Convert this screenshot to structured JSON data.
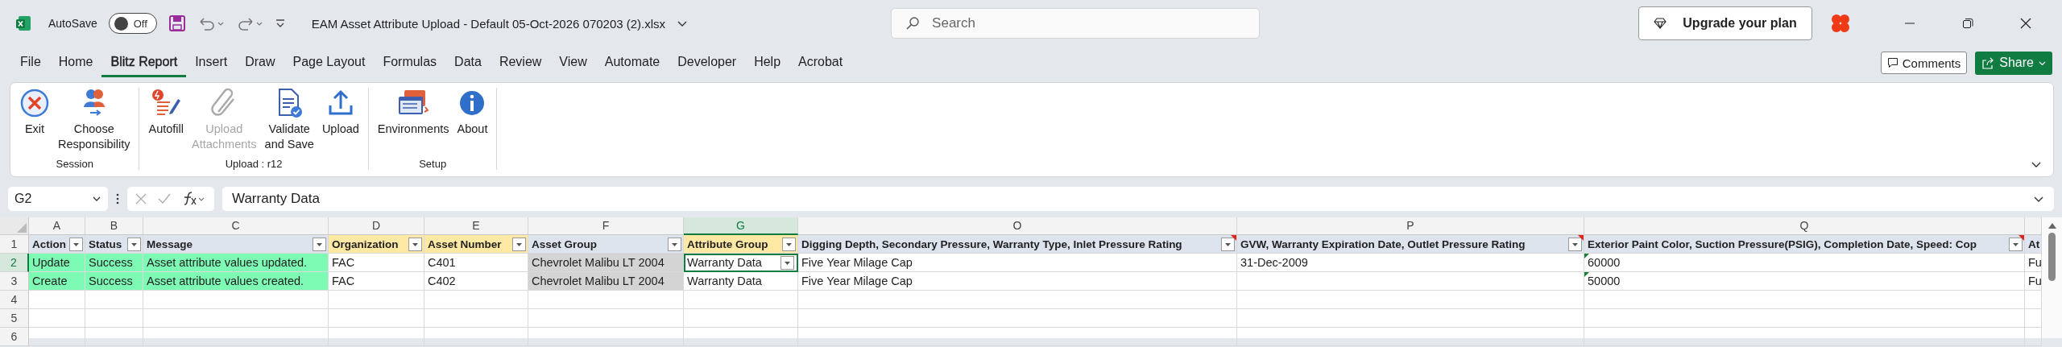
{
  "title_bar": {
    "autosave_label": "AutoSave",
    "autosave": {
      "label": "Off",
      "on": false
    },
    "file_name": "EAM Asset Attribute Upload - Default 05-Oct-2026 070203 (2).xlsx",
    "search": {
      "placeholder": "Search"
    },
    "upgrade_button": "Upgrade your plan"
  },
  "tabs": [
    {
      "label": "File",
      "selected": false
    },
    {
      "label": "Home",
      "selected": false
    },
    {
      "label": "Blitz Report",
      "selected": true
    },
    {
      "label": "Insert",
      "selected": false
    },
    {
      "label": "Draw",
      "selected": false
    },
    {
      "label": "Page Layout",
      "selected": false
    },
    {
      "label": "Formulas",
      "selected": false
    },
    {
      "label": "Data",
      "selected": false
    },
    {
      "label": "Review",
      "selected": false
    },
    {
      "label": "View",
      "selected": false
    },
    {
      "label": "Automate",
      "selected": false
    },
    {
      "label": "Developer",
      "selected": false
    },
    {
      "label": "Help",
      "selected": false
    },
    {
      "label": "Acrobat",
      "selected": false
    }
  ],
  "comments_button": "Comments",
  "share_button": "Share",
  "ribbon": {
    "groups": [
      {
        "label": "Session",
        "buttons": [
          {
            "kind": "exit",
            "lines": [
              "Exit"
            ],
            "disabled": false
          },
          {
            "kind": "responsibility",
            "lines": [
              "Choose",
              "Responsibility"
            ],
            "disabled": false
          }
        ]
      },
      {
        "label": "Upload : r12",
        "buttons": [
          {
            "kind": "autofill",
            "lines": [
              "Autofill"
            ],
            "disabled": false
          },
          {
            "kind": "attachment",
            "lines": [
              "Upload",
              "Attachments"
            ],
            "disabled": true
          },
          {
            "kind": "validate",
            "lines": [
              "Validate",
              "and Save"
            ],
            "disabled": false
          },
          {
            "kind": "upload",
            "lines": [
              "Upload"
            ],
            "disabled": false
          }
        ]
      },
      {
        "label": "Setup",
        "buttons": [
          {
            "kind": "environments",
            "lines": [
              "Environments"
            ],
            "disabled": false
          },
          {
            "kind": "about",
            "lines": [
              "About"
            ],
            "disabled": false
          }
        ]
      }
    ]
  },
  "formula_bar": {
    "name_box": "G2",
    "value": "Warranty Data"
  },
  "sheet": {
    "columns": [
      {
        "letter": "A",
        "header": "Action",
        "color": "#dde4ee",
        "comment": false,
        "selected": false
      },
      {
        "letter": "B",
        "header": "Status",
        "color": "#dde4ee",
        "comment": false,
        "selected": false
      },
      {
        "letter": "C",
        "header": "Message",
        "color": "#dde4ee",
        "comment": false,
        "selected": false
      },
      {
        "letter": "D",
        "header": "Organization",
        "color": "#fde8a4",
        "comment": false,
        "selected": false
      },
      {
        "letter": "E",
        "header": "Asset Number",
        "color": "#fde8a4",
        "comment": false,
        "selected": false
      },
      {
        "letter": "F",
        "header": "Asset Group",
        "color": "#dde4ee",
        "comment": false,
        "selected": false
      },
      {
        "letter": "G",
        "header": "Attribute Group",
        "color": "#fde8a4",
        "comment": false,
        "selected": true
      },
      {
        "letter": "O",
        "header": "Digging Depth, Secondary Pressure, Warranty Type, Inlet Pressure Rating",
        "color": "#dde4ee",
        "comment": true,
        "selected": false
      },
      {
        "letter": "P",
        "header": "GVW, Warranty Expiration Date, Outlet Pressure Rating",
        "color": "#dde4ee",
        "comment": true,
        "selected": false
      },
      {
        "letter": "Q",
        "header": "Exterior Paint Color, Suction Pressure(PSIG), Completion Date, Speed: Cop",
        "color": "#dde4ee",
        "comment": true,
        "selected": false
      },
      {
        "header": "At",
        "color": "#dde4ee",
        "comment": false,
        "selected": false
      }
    ],
    "header_row": {
      "number": "1",
      "selected": false
    },
    "rows": [
      {
        "number": "2",
        "selected": true,
        "cells": [
          {
            "text": "Update",
            "color": "#7dfab4"
          },
          {
            "text": "Success",
            "color": "#7dfab4"
          },
          {
            "text": "Asset attribute values updated.",
            "color": "#7dfab4"
          },
          {
            "text": "FAC"
          },
          {
            "text": "C401"
          },
          {
            "text": "Chevrolet Malibu LT 2004",
            "color": "#d4d4d4"
          },
          {
            "text": "Warranty Data"
          },
          {
            "text": "Five Year Milage Cap"
          },
          {
            "text": "31-Dec-2009"
          },
          {
            "text": "60000",
            "flag": true
          },
          {
            "text": "Fu"
          }
        ]
      },
      {
        "number": "3",
        "selected": false,
        "cells": [
          {
            "text": "Create",
            "color": "#7dfab4"
          },
          {
            "text": "Success",
            "color": "#7dfab4"
          },
          {
            "text": "Asset attribute values created.",
            "color": "#7dfab4"
          },
          {
            "text": "FAC"
          },
          {
            "text": "C402"
          },
          {
            "text": "Chevrolet Malibu LT 2004",
            "color": "#d4d4d4"
          },
          {
            "text": "Warranty Data"
          },
          {
            "text": "Five Year Milage Cap"
          },
          {},
          {
            "text": "50000",
            "flag": true
          },
          {
            "text": "Fu"
          }
        ]
      },
      {
        "number": "4",
        "selected": false,
        "cells": []
      },
      {
        "number": "5",
        "selected": false,
        "cells": []
      },
      {
        "number": "6",
        "selected": false,
        "cells": []
      }
    ]
  }
}
